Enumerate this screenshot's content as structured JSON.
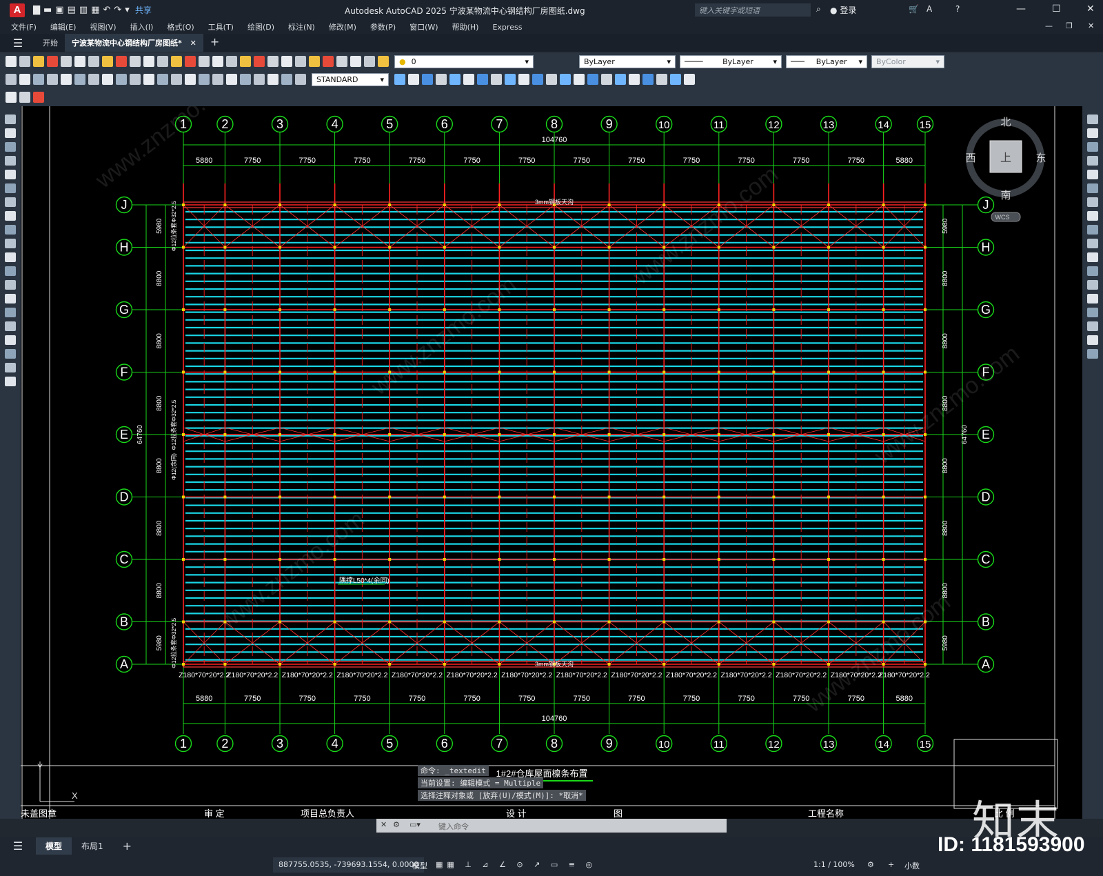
{
  "titlebar": {
    "app_logo": "A",
    "share": "共享",
    "title": "Autodesk AutoCAD 2025    宁波某物流中心钢结构厂房图纸.dwg",
    "search_placeholder": "键入关键字或短语",
    "login": "登录"
  },
  "menu": [
    "文件(F)",
    "编辑(E)",
    "视图(V)",
    "插入(I)",
    "格式(O)",
    "工具(T)",
    "绘图(D)",
    "标注(N)",
    "修改(M)",
    "参数(P)",
    "窗口(W)",
    "帮助(H)",
    "Express"
  ],
  "tabs": {
    "start": "开始",
    "drawing": "宁波某物流中心钢结构厂房图纸*"
  },
  "toolbar": {
    "layer_value": "0",
    "text_style": "STANDARD",
    "color": "ByLayer",
    "linetype": "ByLayer",
    "lineweight": "ByLayer",
    "plotstyle": "ByColor"
  },
  "viewcube": {
    "north": "北",
    "south": "南",
    "west": "西",
    "east": "东",
    "top": "上",
    "wcs": "WCS"
  },
  "drawing": {
    "axes_x": [
      "1",
      "2",
      "3",
      "4",
      "5",
      "6",
      "7",
      "8",
      "9",
      "10",
      "11",
      "12",
      "13",
      "14",
      "15"
    ],
    "axes_y": [
      "J",
      "H",
      "G",
      "F",
      "E",
      "D",
      "C",
      "B",
      "A"
    ],
    "bay_dims": [
      "5880",
      "7750",
      "7750",
      "7750",
      "7750",
      "7750",
      "7750",
      "7750",
      "7750",
      "7750",
      "7750",
      "7750",
      "7750",
      "5880"
    ],
    "overall_x": "104760",
    "span_dims": [
      "5980",
      "8800",
      "8800",
      "8800",
      "8800",
      "8800",
      "8800",
      "5980"
    ],
    "overall_y": "64760",
    "purlin_label": "Z180*70*20*2.2",
    "gutter_label": "3mm钢板天沟",
    "brace_label": "隅撑L50*4(余同)",
    "left_notes": [
      "Φ12拉条套Φ32*2.5",
      "Φ12拉条套Φ32*2.5",
      "Φ12(余同)",
      "Φ12拉条套Φ32*2.5"
    ],
    "drawing_title": "1#2#仓库屋面檩条布置"
  },
  "titleblock": [
    "未盖图章",
    "审  定",
    "项目总负责人",
    "设  计",
    "图",
    "工程名称",
    "比  例"
  ],
  "command": {
    "history": [
      "命令: _textedit",
      "当前设置: 编辑模式 = Multiple",
      "选择注释对象或 [放弃(U)/模式(M)]: *取消*"
    ],
    "input_placeholder": "键入命令"
  },
  "layout_tabs": [
    "模型",
    "布局1"
  ],
  "status": {
    "coords": "887755.0535, -739693.1554, 0.0000",
    "model": "模型",
    "scale": "1:1 / 100%",
    "units": "小数"
  },
  "watermark": {
    "logo": "知末",
    "id": "ID: 1181593900",
    "site": "www.znzmo.com"
  }
}
